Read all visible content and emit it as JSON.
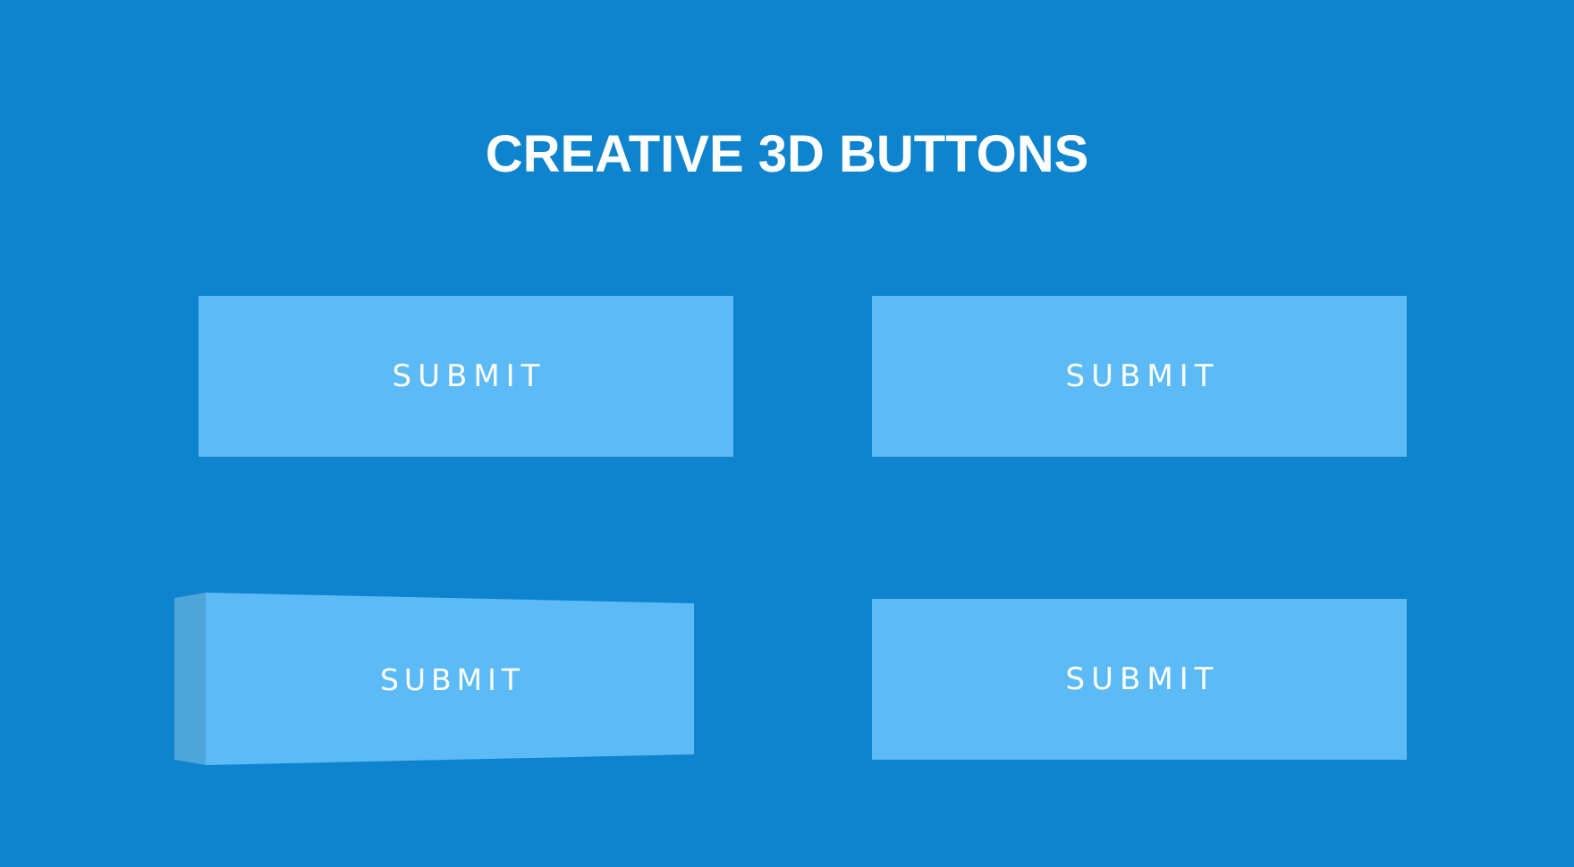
{
  "page": {
    "title": "CREATIVE 3D BUTTONS",
    "background_color": "#0e83ce"
  },
  "buttons": [
    {
      "label": "SUBMIT",
      "color": "#5cbbf6"
    },
    {
      "label": "SUBMIT",
      "color": "#5cbbf6"
    },
    {
      "label": "SUBMIT",
      "color": "#5cbbf6",
      "side_color": "#4ea5d8"
    },
    {
      "label": "SUBMIT",
      "color": "#5cbbf6"
    }
  ]
}
